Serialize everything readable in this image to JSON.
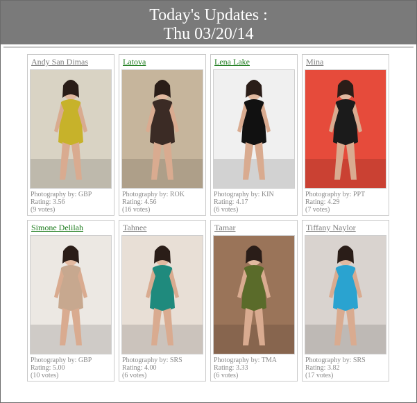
{
  "header": {
    "line1": "Today's Updates :",
    "line2": "Thu 03/20/14"
  },
  "cards": [
    {
      "name": "Andy San Dimas",
      "link_color": "gray",
      "photography": "Photography by: GBP",
      "rating": "Rating: 3.56",
      "votes": "(9 votes)",
      "bg": "#d9d3c4",
      "accent": "#c7b22a"
    },
    {
      "name": "Latova",
      "link_color": "green",
      "photography": "Photography by: ROK",
      "rating": "Rating: 4.56",
      "votes": "(16 votes)",
      "bg": "#c6b59c",
      "accent": "#3b2b25"
    },
    {
      "name": "Lena Lake",
      "link_color": "green",
      "photography": "Photography by: KIN",
      "rating": "Rating: 4.17",
      "votes": "(6 votes)",
      "bg": "#f0f0f0",
      "accent": "#111111"
    },
    {
      "name": "Mina",
      "link_color": "gray",
      "photography": "Photography by: PPT",
      "rating": "Rating: 4.29",
      "votes": "(7 votes)",
      "bg": "#e64b3b",
      "accent": "#1b1b1b"
    },
    {
      "name": "Simone Delilah",
      "link_color": "green",
      "photography": "Photography by: GBP",
      "rating": "Rating: 5.00",
      "votes": "(10 votes)",
      "bg": "#ece8e3",
      "accent": "#c7a88f"
    },
    {
      "name": "Tahnee",
      "link_color": "gray",
      "photography": "Photography by: SRS",
      "rating": "Rating: 4.00",
      "votes": "(6 votes)",
      "bg": "#e8dfd6",
      "accent": "#1f8a7d"
    },
    {
      "name": "Tamar",
      "link_color": "gray",
      "photography": "Photography by: TMA",
      "rating": "Rating: 3.33",
      "votes": "(6 votes)",
      "bg": "#9a7459",
      "accent": "#5a6b2a"
    },
    {
      "name": "Tiffany Naylor",
      "link_color": "gray",
      "photography": "Photography by: SRS",
      "rating": "Rating: 3.82",
      "votes": "(17 votes)",
      "bg": "#d9d3cf",
      "accent": "#2aa3d0"
    }
  ]
}
